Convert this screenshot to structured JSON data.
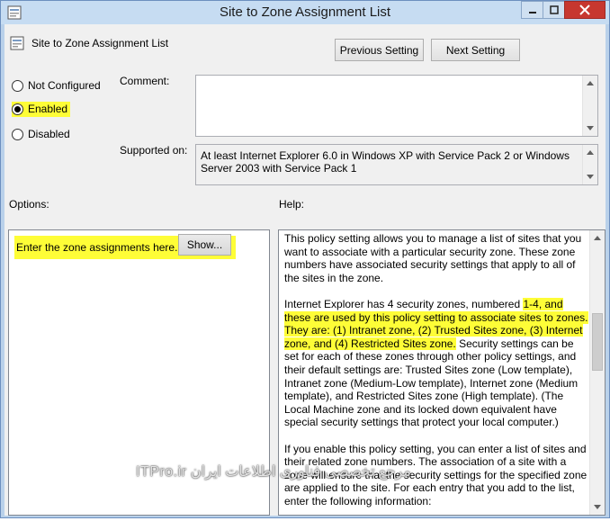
{
  "window": {
    "title": "Site to Zone Assignment List",
    "min_icon": "minimize-icon",
    "max_icon": "maximize-icon",
    "close_icon": "close-icon",
    "close_color": "#c7372f"
  },
  "header": {
    "policy_name": "Site to Zone Assignment List",
    "prev_label": "Previous Setting",
    "next_label": "Next Setting"
  },
  "state": {
    "options": [
      {
        "label": "Not Configured",
        "selected": false
      },
      {
        "label": "Enabled",
        "selected": true
      },
      {
        "label": "Disabled",
        "selected": false
      }
    ]
  },
  "comment": {
    "label": "Comment:",
    "value": ""
  },
  "supported": {
    "label": "Supported on:",
    "value": "At least Internet Explorer 6.0 in Windows XP with Service Pack 2 or Windows Server 2003 with Service Pack 1"
  },
  "options_section": {
    "label": "Options:",
    "prompt": "Enter the zone assignments here.",
    "show_label": "Show..."
  },
  "help_section": {
    "label": "Help:",
    "p1": "This policy setting allows you to manage a list of sites that you want to associate with a particular security zone. These zone numbers have associated security settings that apply to all of the sites in the zone.",
    "p2a": "Internet Explorer has 4 security zones, numbered ",
    "p2b": "1-4, and these are used by this policy setting to associate sites to zones. They are: (1) Intranet zone, (2) Trusted Sites zone, (3) Internet zone, and (4) Restricted Sites zone.",
    "p2c": " Security settings can be set for each of these zones through other policy settings, and their default settings are: Trusted Sites zone (Low template), Intranet zone (Medium-Low template), Internet zone (Medium template), and Restricted Sites zone (High template). (The Local Machine zone and its locked down equivalent have special security settings that protect your local computer.)",
    "p3": "If you enable this policy setting, you can enter a list of sites and their related zone numbers. The association of a site with a zone will ensure that the security settings for the specified zone are applied to the site. For each entry that you add to the list, enter the following information:"
  },
  "watermark": "مرجع تخصصی فناوری اطلاعات ایران ITPro.ir",
  "highlight_color": "#fefd37"
}
